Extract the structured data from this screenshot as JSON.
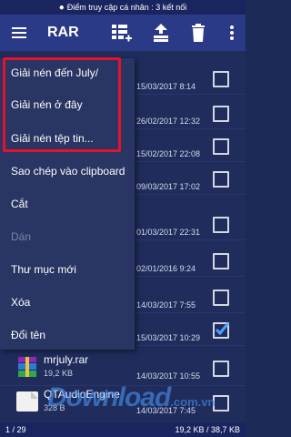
{
  "status_bar": {
    "text": "Điểm truy cập cá nhân : 3 kết nối"
  },
  "toolbar": {
    "title": "RAR",
    "icons": [
      "menu-icon",
      "add-to-archive-icon",
      "extract-icon",
      "delete-icon",
      "more-options-icon"
    ]
  },
  "popup_menu": {
    "items": [
      {
        "label": "Giải nén đến July/",
        "enabled": true
      },
      {
        "label": "Giải nén ở đây",
        "enabled": true
      },
      {
        "label": "Giải nén tệp tin...",
        "enabled": true
      },
      {
        "label": "Sao chép vào clipboard",
        "enabled": true
      },
      {
        "label": "Cắt",
        "enabled": true
      },
      {
        "label": "Dán",
        "enabled": false
      },
      {
        "label": "Thư mục mới",
        "enabled": true
      },
      {
        "label": "Xóa",
        "enabled": true
      },
      {
        "label": "Đổi tên",
        "enabled": true
      }
    ]
  },
  "file_rows": [
    {
      "date": "15/03/2017 8:14",
      "checked": false
    },
    {
      "date": "26/02/2017 12:32",
      "checked": false
    },
    {
      "date": "15/02/2017 22:08",
      "checked": false
    },
    {
      "date": "09/03/2017 17:02",
      "checked": false
    },
    {
      "date": "01/03/2017 22:31",
      "checked": false
    },
    {
      "date": "02/01/2016 9:24",
      "checked": false
    },
    {
      "date": "14/03/2017 7:55",
      "checked": false
    },
    {
      "date": "15/03/2017 10:29",
      "checked": true
    },
    {
      "name": "mrjuly.rar",
      "size": "19,2 KB",
      "date": "14/03/2017 10:55",
      "checked": false
    },
    {
      "name": "QTAudioEngine",
      "size": "328 B",
      "date": "14/03/2017 7:45",
      "checked": false
    }
  ],
  "footer": {
    "page": "1 / 29",
    "size": "19,2 KB / 38,7 KB"
  },
  "watermark": {
    "text": "Download",
    "suffix": ".com.vn"
  },
  "colors": {
    "accent": "#2a3a86",
    "highlight": "#e3132f",
    "check": "#4aa3ff"
  }
}
